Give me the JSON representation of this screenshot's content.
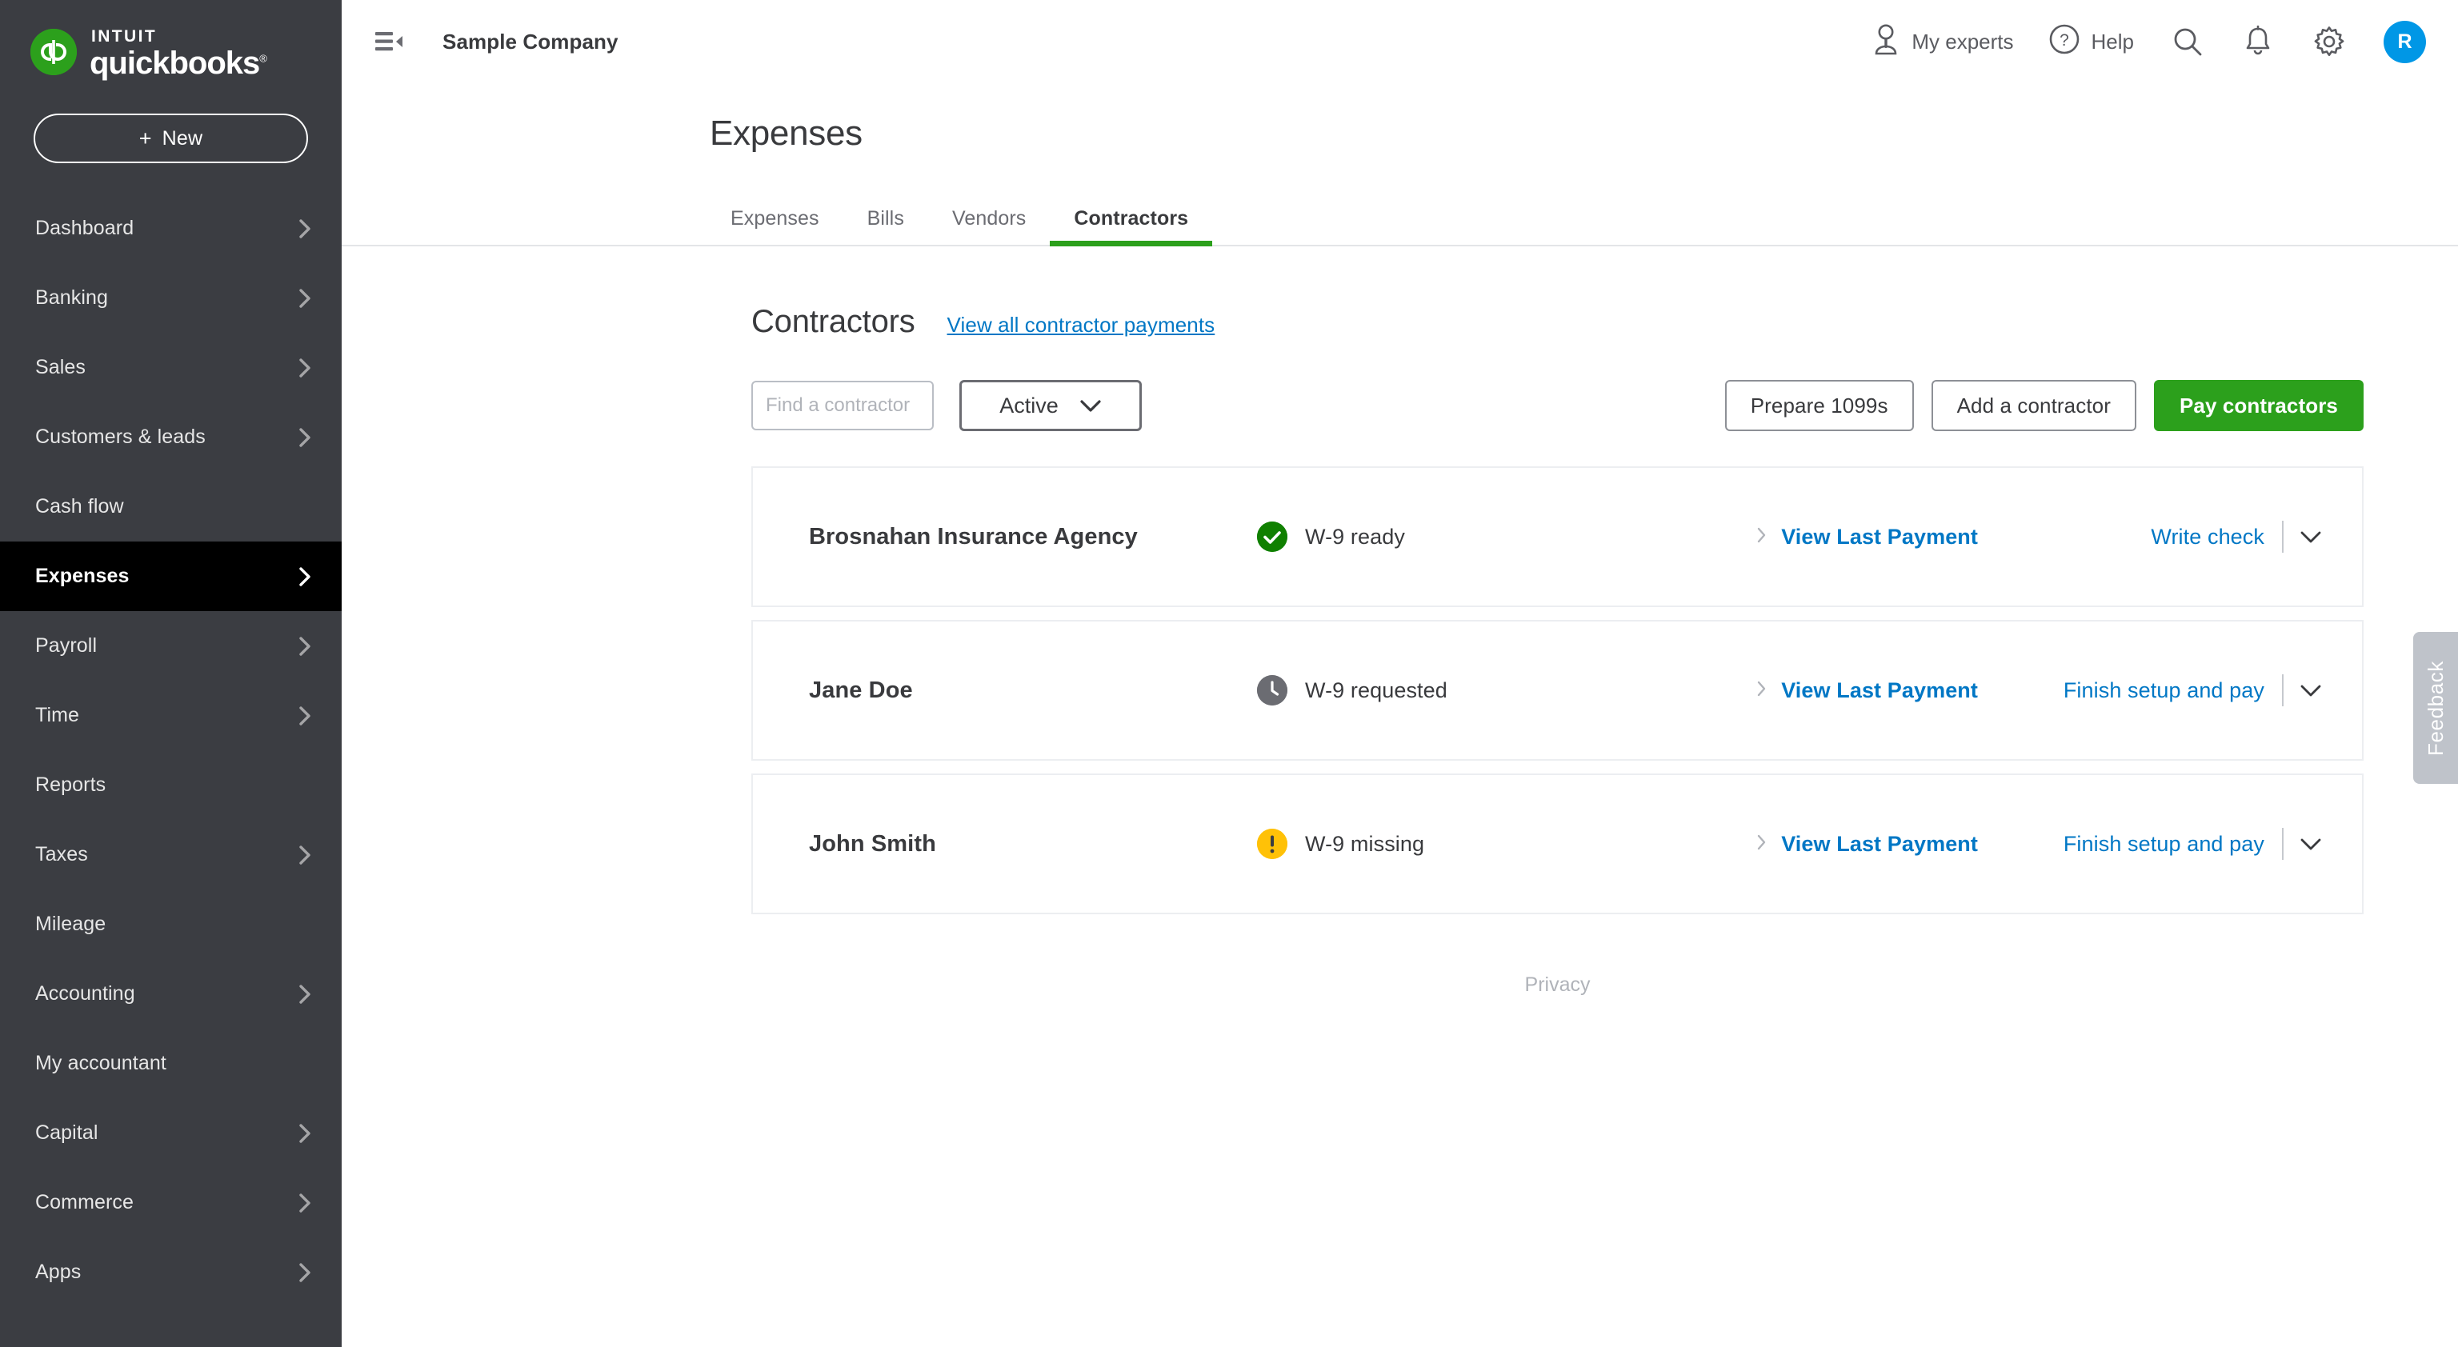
{
  "sidebar": {
    "brand": {
      "intuit": "INTUIT",
      "name": "quickbooks",
      "registered": "®"
    },
    "new_button": {
      "plus": "+",
      "label": "New"
    },
    "items": [
      {
        "label": "Dashboard",
        "chevron": true,
        "active": false
      },
      {
        "label": "Banking",
        "chevron": true,
        "active": false
      },
      {
        "label": "Sales",
        "chevron": true,
        "active": false
      },
      {
        "label": "Customers & leads",
        "chevron": true,
        "active": false
      },
      {
        "label": "Cash flow",
        "chevron": false,
        "active": false
      },
      {
        "label": "Expenses",
        "chevron": true,
        "active": true
      },
      {
        "label": "Payroll",
        "chevron": true,
        "active": false
      },
      {
        "label": "Time",
        "chevron": true,
        "active": false
      },
      {
        "label": "Reports",
        "chevron": false,
        "active": false
      },
      {
        "label": "Taxes",
        "chevron": true,
        "active": false
      },
      {
        "label": "Mileage",
        "chevron": false,
        "active": false
      },
      {
        "label": "Accounting",
        "chevron": true,
        "active": false
      },
      {
        "label": "My accountant",
        "chevron": false,
        "active": false
      },
      {
        "label": "Capital",
        "chevron": true,
        "active": false
      },
      {
        "label": "Commerce",
        "chevron": true,
        "active": false
      },
      {
        "label": "Apps",
        "chevron": true,
        "active": false
      }
    ]
  },
  "topbar": {
    "menu_icon": "hamburger-collapse-icon",
    "company_name": "Sample Company",
    "my_experts_label": "My experts",
    "help_label": "Help",
    "search_icon": "search-icon",
    "notifications_icon": "bell-icon",
    "settings_icon": "gear-icon",
    "avatar_initial": "R"
  },
  "page": {
    "title": "Expenses",
    "tabs": [
      {
        "label": "Expenses",
        "active": false
      },
      {
        "label": "Bills",
        "active": false
      },
      {
        "label": "Vendors",
        "active": false
      },
      {
        "label": "Contractors",
        "active": true
      }
    ]
  },
  "section": {
    "title": "Contractors",
    "view_all_link": "View all contractor payments"
  },
  "toolbar": {
    "search_placeholder": "Find a contractor",
    "search_value": "",
    "status_filter": "Active",
    "buttons": [
      {
        "label": "Prepare 1099s",
        "style": "outline"
      },
      {
        "label": "Add a contractor",
        "style": "outline"
      },
      {
        "label": "Pay contractors",
        "style": "primary"
      }
    ]
  },
  "contractors": [
    {
      "name": "Brosnahan Insurance Agency",
      "status": "W-9 ready",
      "status_type": "ready",
      "status_icon": "check-circle-icon",
      "view_last_payment": "View Last Payment",
      "action": "Write check"
    },
    {
      "name": "Jane Doe",
      "status": "W-9 requested",
      "status_type": "requested",
      "status_icon": "clock-circle-icon",
      "view_last_payment": "View Last Payment",
      "action": "Finish setup and pay"
    },
    {
      "name": "John Smith",
      "status": "W-9 missing",
      "status_type": "missing",
      "status_icon": "warning-circle-icon",
      "view_last_payment": "View Last Payment",
      "action": "Finish setup and pay"
    }
  ],
  "footer": {
    "privacy": "Privacy"
  },
  "feedback": {
    "label": "Feedback"
  },
  "colors": {
    "brand_green": "#2ca01c",
    "link_blue": "#0077c5",
    "avatar_blue": "#0097e6",
    "sidebar_bg": "#3b3d42",
    "active_item_bg": "#000000",
    "status_ready": "#108000",
    "status_requested": "#6b6c72",
    "status_missing": "#ffc107"
  }
}
